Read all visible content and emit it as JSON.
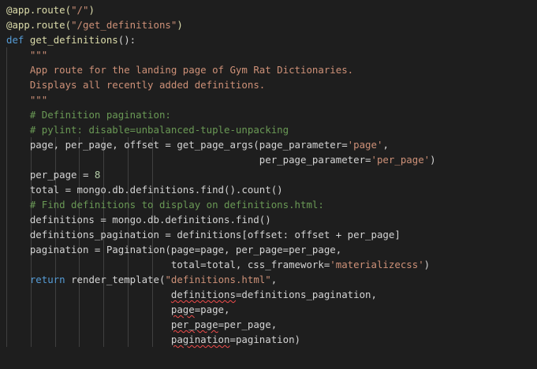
{
  "code_lines": [
    [
      {
        "t": "@app.route(",
        "c": "dec"
      },
      {
        "t": "\"/\"",
        "c": "str"
      },
      {
        "t": ")",
        "c": "dec"
      }
    ],
    [
      {
        "t": "@app.route(",
        "c": "dec"
      },
      {
        "t": "\"/get_definitions\"",
        "c": "str"
      },
      {
        "t": ")",
        "c": "dec"
      }
    ],
    [
      {
        "t": "def",
        "c": "kw"
      },
      {
        "t": " "
      },
      {
        "t": "get_definitions",
        "c": "fn"
      },
      {
        "t": "():"
      }
    ],
    [
      {
        "t": "    "
      },
      {
        "t": "\"\"\"",
        "c": "str"
      }
    ],
    [
      {
        "t": "    "
      },
      {
        "t": "App route for the landing page of Gym Rat Dictionaries.",
        "c": "str"
      }
    ],
    [
      {
        "t": "    "
      },
      {
        "t": "Displays all recently added definitions.",
        "c": "str"
      }
    ],
    [
      {
        "t": "    "
      },
      {
        "t": "\"\"\"",
        "c": "str"
      }
    ],
    [
      {
        "t": "    "
      },
      {
        "t": "# Definition pagination:",
        "c": "cmt"
      }
    ],
    [
      {
        "t": "    "
      },
      {
        "t": "# pylint: disable=unbalanced-tuple-unpacking",
        "c": "cmt"
      }
    ],
    [
      {
        "t": "    page, per_page, offset = get_page_args(page_parameter="
      },
      {
        "t": "'page'",
        "c": "str"
      },
      {
        "t": ","
      }
    ],
    [
      {
        "t": "                                           per_page_parameter="
      },
      {
        "t": "'per_page'",
        "c": "str"
      },
      {
        "t": ")"
      }
    ],
    [
      {
        "t": "    per_page = "
      },
      {
        "t": "8",
        "c": "num"
      }
    ],
    [
      {
        "t": "    total = mongo.db.definitions.find().count()"
      }
    ],
    [
      {
        "t": "    "
      },
      {
        "t": "# Find definitions to display on definitions.html:",
        "c": "cmt"
      }
    ],
    [
      {
        "t": "    definitions = mongo.db.definitions.find()"
      }
    ],
    [
      {
        "t": "    definitions_pagination = definitions[offset: offset + per_page]"
      }
    ],
    [
      {
        "t": "    pagination = Pagination(page=page, per_page=per_page,"
      }
    ],
    [
      {
        "t": "                            total=total, css_framework="
      },
      {
        "t": "'materializecss'",
        "c": "str"
      },
      {
        "t": ")"
      }
    ],
    [
      {
        "t": "    "
      },
      {
        "t": "return",
        "c": "kw"
      },
      {
        "t": " render_template("
      },
      {
        "t": "\"definitions.html\"",
        "c": "str"
      },
      {
        "t": ","
      }
    ],
    [
      {
        "t": "                            "
      },
      {
        "t": "definitions",
        "u": true
      },
      {
        "t": "=definitions_pagination,"
      }
    ],
    [
      {
        "t": "                            "
      },
      {
        "t": "page",
        "u": true
      },
      {
        "t": "=page,"
      }
    ],
    [
      {
        "t": "                            "
      },
      {
        "t": "per_page",
        "u": true
      },
      {
        "t": "=per_page,"
      }
    ],
    [
      {
        "t": "                            "
      },
      {
        "t": "pagination",
        "u": true
      },
      {
        "t": "=pagination)"
      }
    ]
  ],
  "colors": {
    "background": "#1e1e1e",
    "text": "#d4d4d4",
    "decorator": "#dcdcaa",
    "keyword": "#569cd6",
    "function": "#dcdcaa",
    "string": "#ce9178",
    "comment": "#6a9955",
    "number": "#b5cea8",
    "squiggle": "#f14c4c",
    "indent_guide": "#404040"
  }
}
